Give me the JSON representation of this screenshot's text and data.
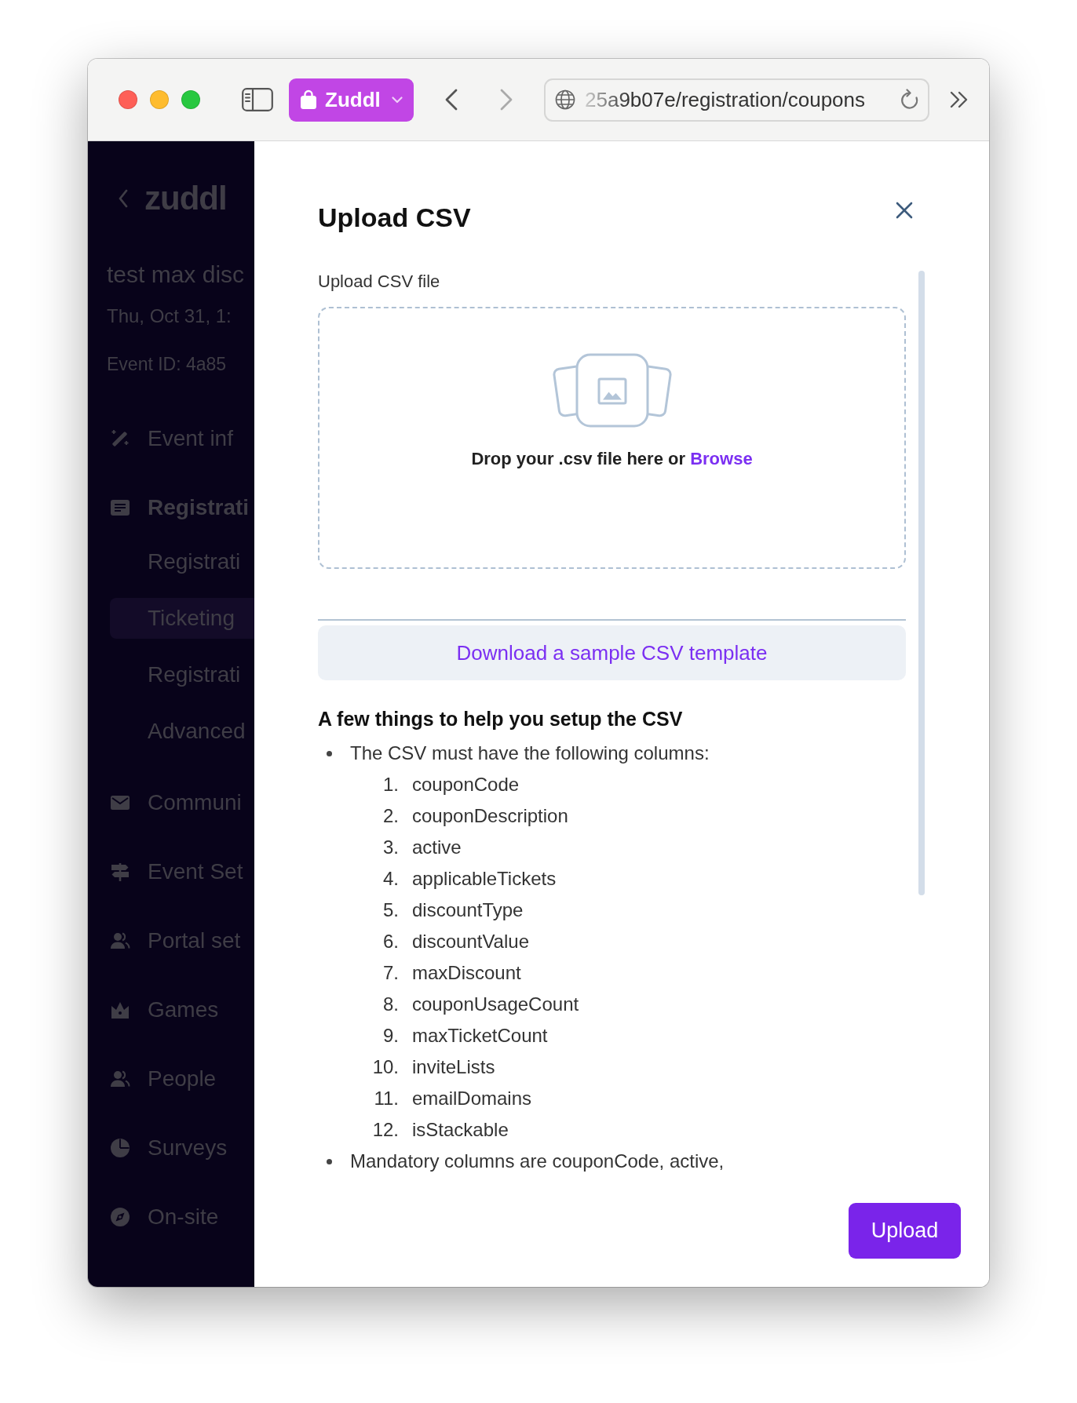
{
  "browser": {
    "tab_group": {
      "label": "Zuddl"
    },
    "address": "25a9b07e/registration/coupons"
  },
  "sidebar": {
    "logo": "zuddl",
    "event": {
      "name": "test max disc",
      "date": "Thu, Oct 31, 1:",
      "event_id": "Event ID: 4a85"
    },
    "items": [
      {
        "label": "Event inf",
        "selected": false
      },
      {
        "label": "Registrati",
        "selected": true,
        "children": [
          {
            "label": "Registrati",
            "selected": false
          },
          {
            "label": "Ticketing",
            "selected": true
          },
          {
            "label": "Registrati",
            "selected": false
          },
          {
            "label": "Advanced",
            "selected": false
          }
        ]
      },
      {
        "label": "Communi",
        "selected": false
      },
      {
        "label": "Event Set",
        "selected": false
      },
      {
        "label": "Portal set",
        "selected": false
      },
      {
        "label": "Games",
        "selected": false
      },
      {
        "label": "People",
        "selected": false
      },
      {
        "label": "Surveys",
        "selected": false
      },
      {
        "label": "On-site",
        "selected": false
      }
    ]
  },
  "drawer": {
    "title": "Upload CSV",
    "field_label": "Upload CSV file",
    "dropzone": {
      "prompt": "Drop your .csv file here or",
      "link": "Browse"
    },
    "template_button": "Download a sample CSV template",
    "help": {
      "heading": "A few things to help you setup the CSV",
      "bullets": [
        {
          "text": "The CSV must have the following columns:",
          "columns": [
            {
              "number": "1.",
              "name": "couponCode"
            },
            {
              "number": "2.",
              "name": "couponDescription"
            },
            {
              "number": "3.",
              "name": "active"
            },
            {
              "number": "4.",
              "name": "applicableTickets"
            },
            {
              "number": "5.",
              "name": "discountType"
            },
            {
              "number": "6.",
              "name": "discountValue"
            },
            {
              "number": "7.",
              "name": "maxDiscount"
            },
            {
              "number": "8.",
              "name": "couponUsageCount"
            },
            {
              "number": "9.",
              "name": "maxTicketCount"
            },
            {
              "number": "10.",
              "name": "inviteLists"
            },
            {
              "number": "11.",
              "name": "emailDomains"
            },
            {
              "number": "12.",
              "name": "isStackable"
            }
          ]
        },
        {
          "text": "Mandatory columns are couponCode, active,"
        }
      ]
    },
    "upload_button": "Upload"
  }
}
